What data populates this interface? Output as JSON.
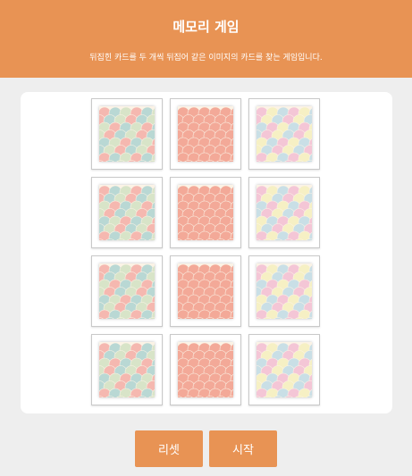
{
  "header": {
    "title": "메모리 게임",
    "subtitle": "뒤집힌 카드를 두 개씩 뒤집어 같은 이미지의 카드를 찾는 게임입니다."
  },
  "board": {
    "rows": 4,
    "cols": 3,
    "card_back": "pastel-scales-pattern"
  },
  "buttons": {
    "reset": "리셋",
    "start": "시작"
  },
  "colors": {
    "accent": "#e89354",
    "background": "#eeeeee",
    "board": "#ffffff"
  }
}
